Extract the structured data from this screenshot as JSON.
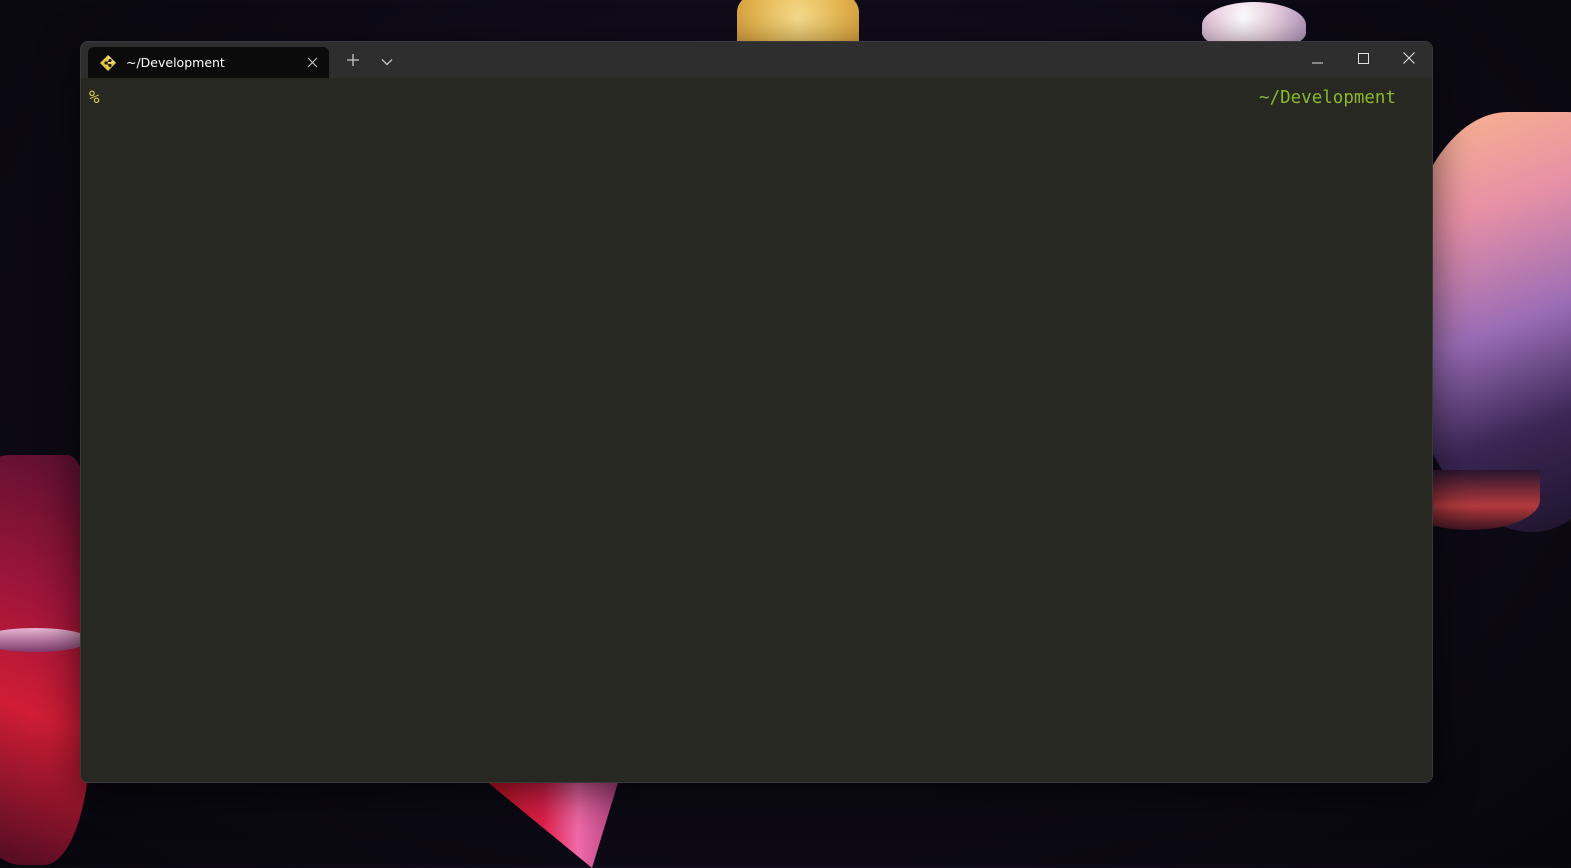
{
  "window": {
    "tab": {
      "title": "~/Development",
      "icon": "git-diamond-icon"
    },
    "controls": {
      "new_tab": "plus-icon",
      "dropdown": "chevron-down-icon",
      "minimize": "minimize-icon",
      "maximize": "maximize-icon",
      "close": "close-icon"
    }
  },
  "terminal": {
    "prompt_symbol": "%",
    "right_prompt": "~/Development",
    "colors": {
      "background": "#272822",
      "prompt": "#d5c04a",
      "path": "#8ab82a"
    }
  }
}
